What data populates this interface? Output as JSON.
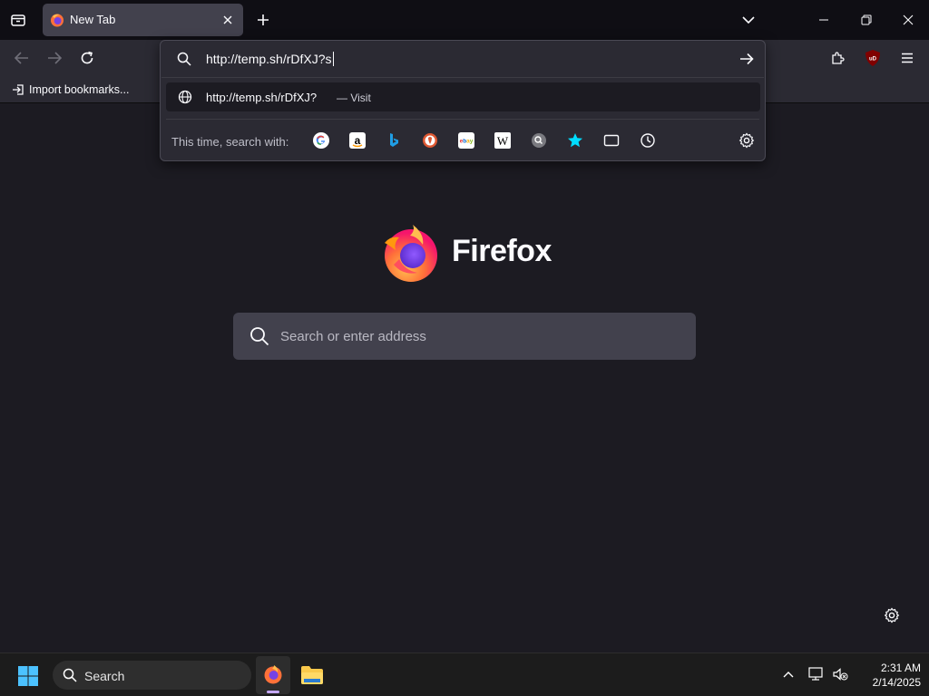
{
  "browser": {
    "tab_title": "New Tab",
    "bookmarks": {
      "import_label": "Import bookmarks..."
    }
  },
  "urlbar": {
    "value": "http://temp.sh/rDfXJ?s",
    "suggestion_url": "http://temp.sh/rDfXJ?",
    "suggestion_action": "— Visit",
    "search_with_label": "This time, search with:",
    "engines": [
      "google-icon",
      "amazon-icon",
      "bing-icon",
      "duckduckgo-icon",
      "ebay-icon",
      "wikipedia-icon",
      "search-engine-icon",
      "bookmarks-star-icon",
      "tabs-icon",
      "history-icon"
    ]
  },
  "newtab": {
    "brand": "Firefox",
    "search_placeholder": "Search or enter address"
  },
  "taskbar": {
    "search_label": "Search",
    "time": "2:31 AM",
    "date": "2/14/2025"
  },
  "colors": {
    "background": "#1c1b22",
    "toolbar": "#2b2a33",
    "accent": "#00ddff"
  }
}
